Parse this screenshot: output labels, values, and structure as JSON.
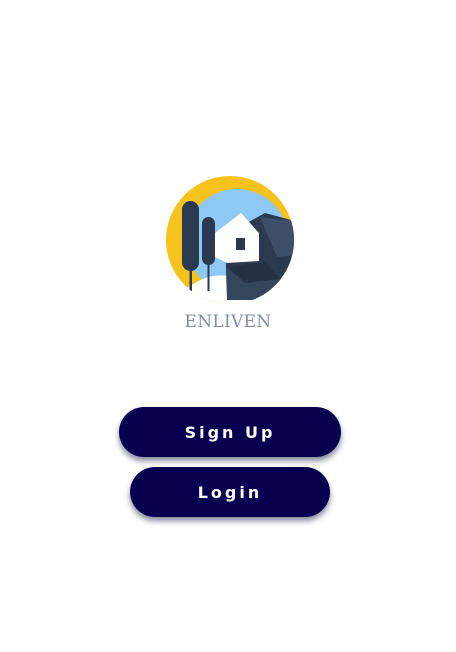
{
  "app": {
    "brand_name": "ENLIVEN",
    "logo_icon": "house-trees-sun-logo-icon"
  },
  "actions": {
    "signup_label": "Sign Up",
    "login_label": "Login"
  },
  "colors": {
    "background": "#ffffff",
    "button_bg": "#08004f",
    "button_text": "#ffffff",
    "brand_text": "#7f8fa0",
    "logo_sun": "#f6c21b",
    "logo_sky": "#8ec9f5",
    "logo_dark": "#2b3a4f"
  }
}
